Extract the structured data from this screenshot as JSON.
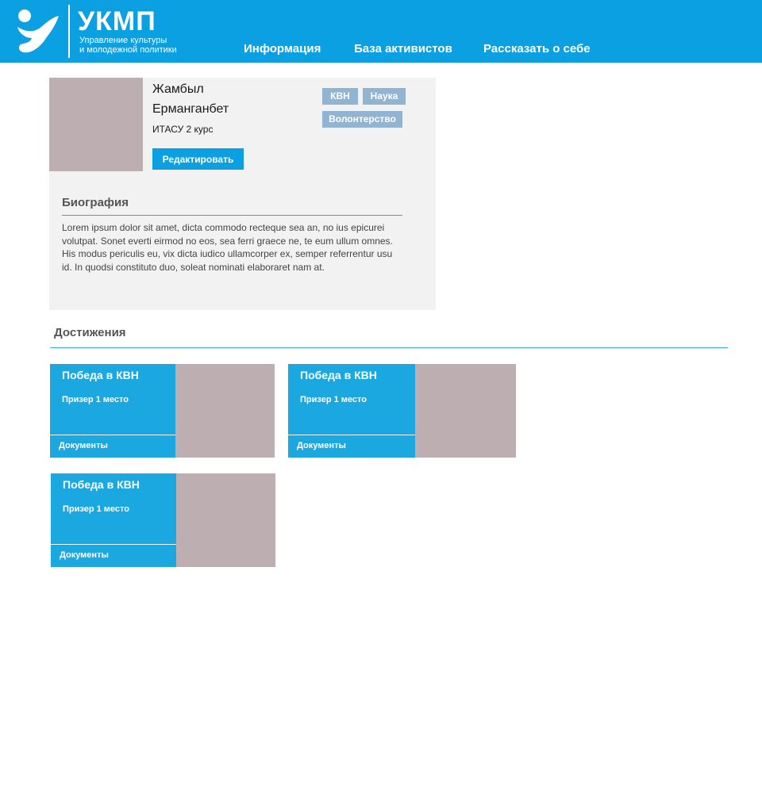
{
  "header": {
    "logo_title": "УКМП",
    "logo_subtitle": [
      "Управление культуры",
      "и молодежной политики"
    ],
    "logo_icon": "person-icon",
    "nav": [
      {
        "label": "Информация"
      },
      {
        "label": "База активистов"
      },
      {
        "label": "Рассказать о себе"
      }
    ],
    "colors": {
      "brand": "#0aa0e1"
    }
  },
  "profile": {
    "first_name": "Жамбыл",
    "last_name": "Ерманганбет",
    "course": "ИТАСУ 2 курс",
    "edit_label": "Редактировать",
    "tags": [
      "КВН",
      "Наука",
      "Волонтерство"
    ],
    "bio_heading": "Биография",
    "bio_text": "Lorem ipsum dolor sit amet, dicta commodo recteque sea an, no ius epicurei volutpat. Sonet everti eirmod no eos, sea ferri graece ne, te eum ullum omnes. His modus periculis eu, vix dicta iudico ullamcorper ex, semper referrentur usu id. In quodsi constituto duo, soleat nominati elaboraret nam at."
  },
  "achievements": {
    "heading": "Достижения",
    "items": [
      {
        "title": "Победа в КВН",
        "place": "Призер 1 место",
        "docs_label": "Документы"
      },
      {
        "title": "Победа в КВН",
        "place": "Призер 1 место",
        "docs_label": "Документы"
      },
      {
        "title": "Победа в КВН",
        "place": "Призер 1 место",
        "docs_label": "Документы"
      }
    ]
  }
}
